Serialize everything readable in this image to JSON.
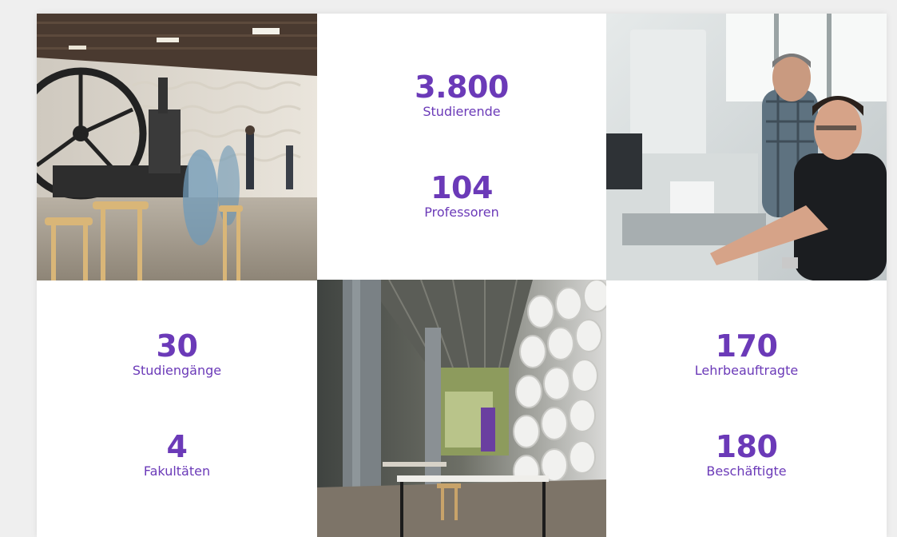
{
  "theme": {
    "accent": "#6b3ab8"
  },
  "stats": {
    "students": {
      "value": "3.800",
      "label": "Studierende"
    },
    "professors": {
      "value": "104",
      "label": "Professoren"
    },
    "programs": {
      "value": "30",
      "label": "Studiengänge"
    },
    "faculties": {
      "value": "4",
      "label": "Fakultäten"
    },
    "lecturers": {
      "value": "170",
      "label": "Lehrbeauftragte"
    },
    "employees": {
      "value": "180",
      "label": "Beschäftigte"
    }
  },
  "photos": [
    {
      "subject": "lobby-with-steam-engine-photo"
    },
    {
      "subject": "two-men-at-lab-computer-photo"
    },
    {
      "subject": "corridor-with-wave-wall-photo"
    }
  ]
}
